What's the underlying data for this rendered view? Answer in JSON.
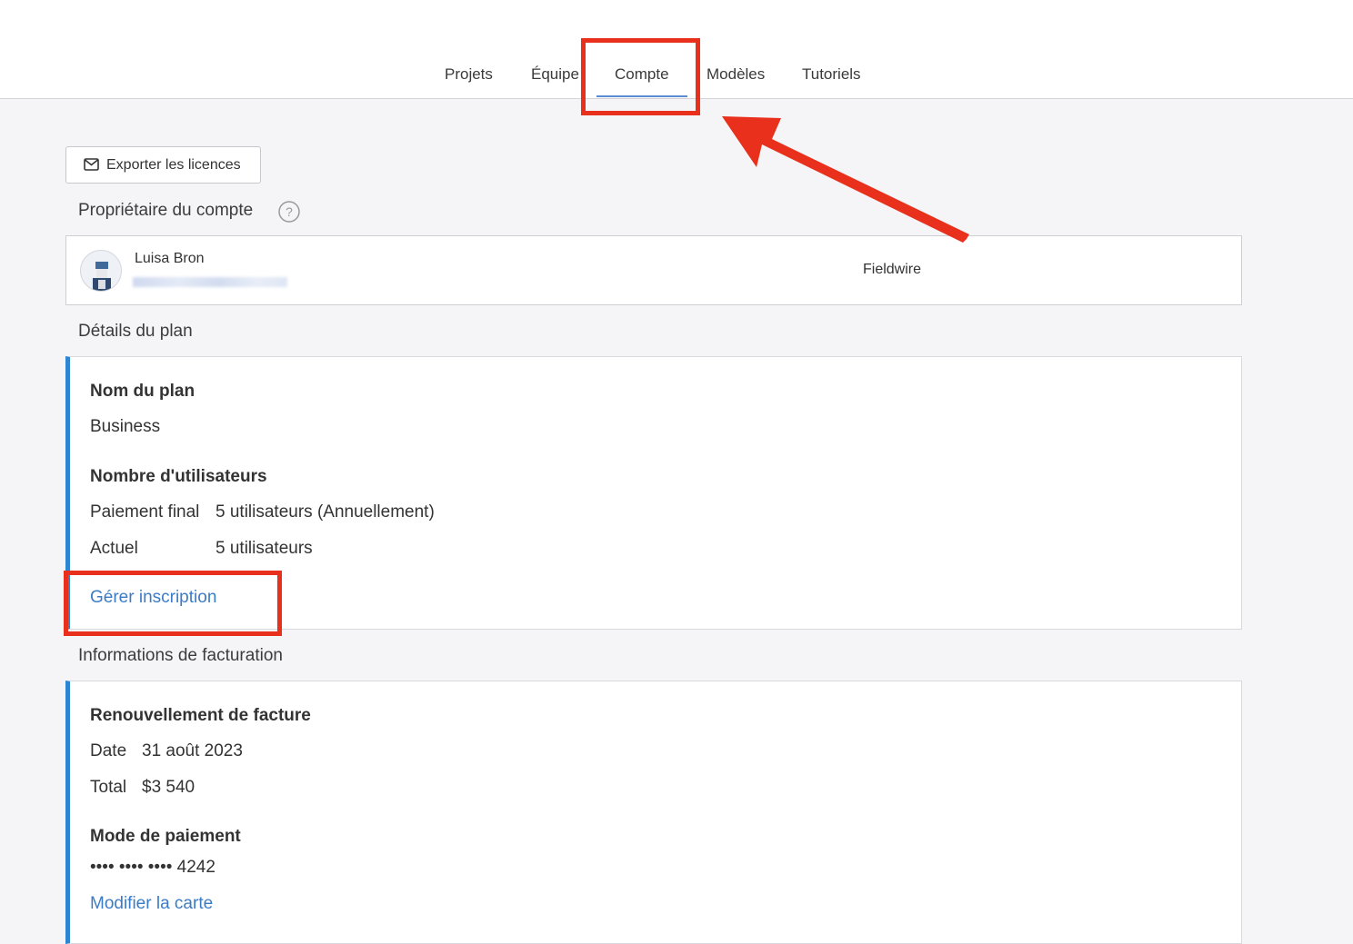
{
  "nav": {
    "tabs": [
      {
        "label": "Projets"
      },
      {
        "label": "Équipe"
      },
      {
        "label": "Compte",
        "active": true
      },
      {
        "label": "Modèles"
      },
      {
        "label": "Tutoriels"
      }
    ]
  },
  "toolbar": {
    "export_label": "Exporter les licences",
    "export_icon": "mail-icon"
  },
  "owner_section": {
    "title": "Propriétaire du compte",
    "help_icon": "help-icon",
    "owner": {
      "name": "Luisa Bron",
      "company": "Fieldwire"
    }
  },
  "plan_section": {
    "title": "Détails du plan",
    "plan_name_label": "Nom du plan",
    "plan_name": "Business",
    "users_label": "Nombre d'utilisateurs",
    "rows": [
      {
        "label": "Paiement final",
        "value": "5 utilisateurs (Annuellement)"
      },
      {
        "label": "Actuel",
        "value": "5 utilisateurs"
      }
    ],
    "manage_link": "Gérer inscription"
  },
  "billing_section": {
    "title": "Informations de facturation",
    "renewal_label": "Renouvellement de facture",
    "rows": [
      {
        "label": "Date",
        "value": "31 août 2023"
      },
      {
        "label": "Total",
        "value": "$3 540"
      }
    ],
    "payment_label": "Mode de paiement",
    "card_number": "•••• •••• •••• 4242",
    "edit_card_link": "Modifier la carte"
  },
  "colors": {
    "accent": "#2e86d1",
    "link": "#3c7cc6",
    "highlight": "#e8301c"
  }
}
